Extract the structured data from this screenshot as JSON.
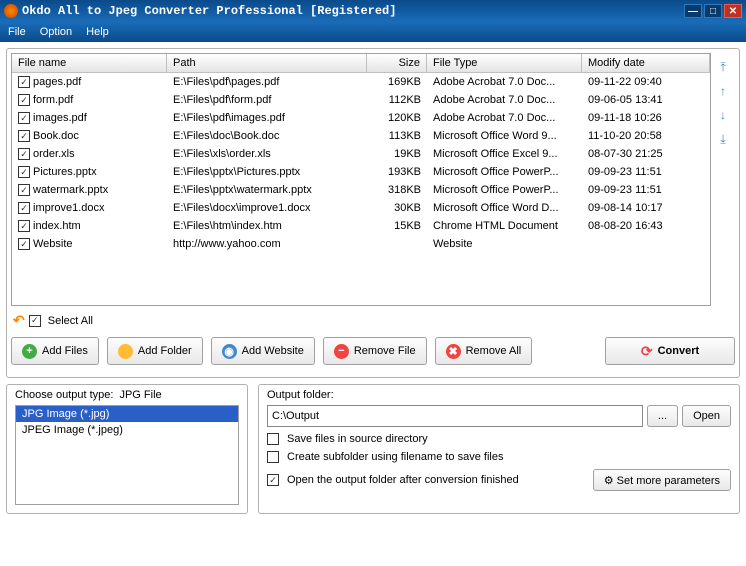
{
  "title": "Okdo All to Jpeg Converter Professional [Registered]",
  "menu": {
    "file": "File",
    "option": "Option",
    "help": "Help"
  },
  "columns": {
    "name": "File name",
    "path": "Path",
    "size": "Size",
    "type": "File Type",
    "date": "Modify date"
  },
  "rows": [
    {
      "name": "pages.pdf",
      "path": "E:\\Files\\pdf\\pages.pdf",
      "size": "169KB",
      "type": "Adobe Acrobat 7.0 Doc...",
      "date": "09-11-22 09:40"
    },
    {
      "name": "form.pdf",
      "path": "E:\\Files\\pdf\\form.pdf",
      "size": "112KB",
      "type": "Adobe Acrobat 7.0 Doc...",
      "date": "09-06-05 13:41"
    },
    {
      "name": "images.pdf",
      "path": "E:\\Files\\pdf\\images.pdf",
      "size": "120KB",
      "type": "Adobe Acrobat 7.0 Doc...",
      "date": "09-11-18 10:26"
    },
    {
      "name": "Book.doc",
      "path": "E:\\Files\\doc\\Book.doc",
      "size": "113KB",
      "type": "Microsoft Office Word 9...",
      "date": "11-10-20 20:58"
    },
    {
      "name": "order.xls",
      "path": "E:\\Files\\xls\\order.xls",
      "size": "19KB",
      "type": "Microsoft Office Excel 9...",
      "date": "08-07-30 21:25"
    },
    {
      "name": "Pictures.pptx",
      "path": "E:\\Files\\pptx\\Pictures.pptx",
      "size": "193KB",
      "type": "Microsoft Office PowerP...",
      "date": "09-09-23 11:51"
    },
    {
      "name": "watermark.pptx",
      "path": "E:\\Files\\pptx\\watermark.pptx",
      "size": "318KB",
      "type": "Microsoft Office PowerP...",
      "date": "09-09-23 11:51"
    },
    {
      "name": "improve1.docx",
      "path": "E:\\Files\\docx\\improve1.docx",
      "size": "30KB",
      "type": "Microsoft Office Word D...",
      "date": "09-08-14 10:17"
    },
    {
      "name": "index.htm",
      "path": "E:\\Files\\htm\\index.htm",
      "size": "15KB",
      "type": "Chrome HTML Document",
      "date": "08-08-20 16:43"
    },
    {
      "name": "Website",
      "path": "http://www.yahoo.com",
      "size": "",
      "type": "Website",
      "date": ""
    }
  ],
  "selectall": "Select All",
  "buttons": {
    "addfiles": "Add Files",
    "addfolder": "Add Folder",
    "addwebsite": "Add Website",
    "removefile": "Remove File",
    "removeall": "Remove All",
    "convert": "Convert"
  },
  "outputtype": {
    "label": "Choose output type:",
    "current": "JPG File",
    "options": [
      "JPG Image (*.jpg)",
      "JPEG Image (*.jpeg)"
    ]
  },
  "outputfolder": {
    "label": "Output folder:",
    "value": "C:\\Output",
    "browse": "...",
    "open": "Open"
  },
  "checks": {
    "source": "Save files in source directory",
    "subfolder": "Create subfolder using filename to save files",
    "openafter": "Open the output folder after conversion finished"
  },
  "moreparams": "Set more parameters"
}
